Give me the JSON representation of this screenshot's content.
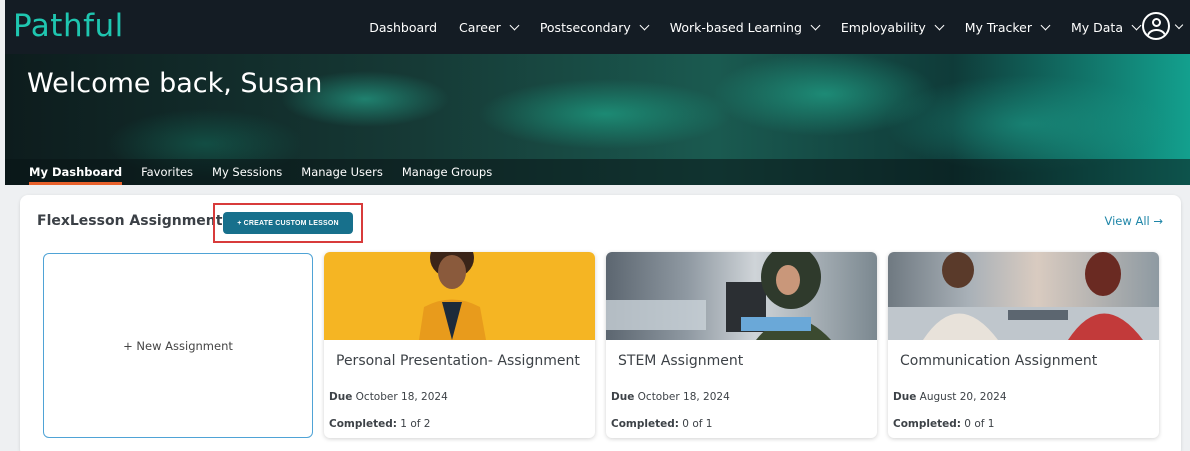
{
  "nav": {
    "logo": "Pathful",
    "items": [
      "Dashboard",
      "Career",
      "Postsecondary",
      "Work-based Learning",
      "Employability",
      "My Tracker",
      "My Data"
    ],
    "dropdown_flags": [
      false,
      true,
      true,
      true,
      true,
      true,
      true
    ]
  },
  "hero": {
    "title": "Welcome back, Susan",
    "tabs": [
      "My Dashboard",
      "Favorites",
      "My Sessions",
      "Manage Users",
      "Manage Groups"
    ],
    "active_tab": "My Dashboard"
  },
  "assignments": {
    "title": "FlexLesson Assignments",
    "create_button": "+ CREATE CUSTOM LESSON",
    "view_all": "View All →",
    "new_assignment": "+ New Assignment",
    "due_label": "Due",
    "completed_label": "Completed:",
    "cards": [
      {
        "title": "Personal Presentation- Assignment",
        "due": "October 18, 2024",
        "completed": "1 of 2"
      },
      {
        "title": "STEM Assignment",
        "due": "October 18, 2024",
        "completed": "0 of 1"
      },
      {
        "title": "Communication Assignment",
        "due": "August 20, 2024",
        "completed": "0 of 1"
      }
    ]
  },
  "colors": {
    "nav_bg": "#141c24",
    "logo": "#1fc6b0",
    "active_tab_underline": "#e8612c",
    "button": "#17708c",
    "highlight": "#d83b3b",
    "link": "#1f86a8"
  }
}
